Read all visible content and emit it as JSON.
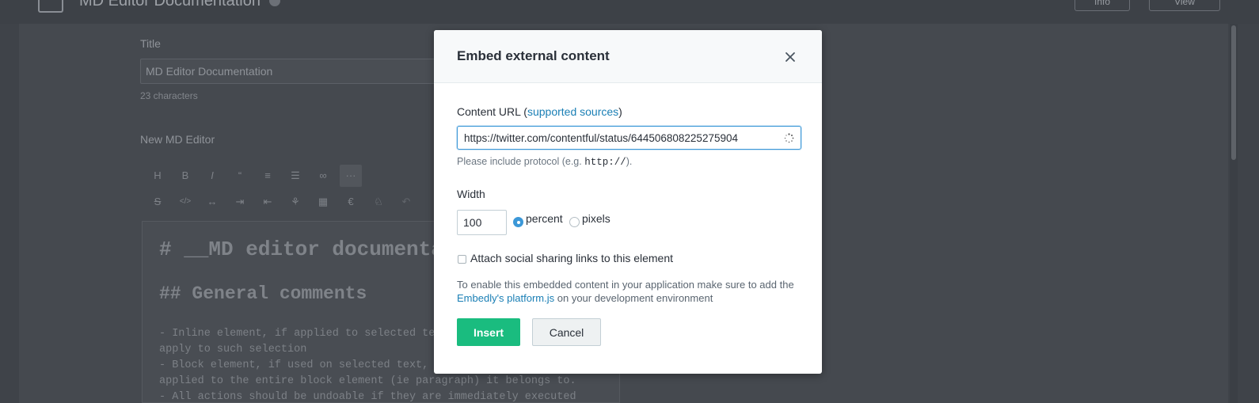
{
  "background": {
    "page_title": "MD Editor Documentation",
    "header_buttons": {
      "info": "Info",
      "view": "View"
    },
    "title_label": "Title",
    "title_value": "MD Editor Documentation",
    "char_count": "23 characters",
    "editor_label": "New MD Editor",
    "toolbar_row1": [
      "H",
      "B",
      "I",
      "“",
      "≡",
      "☰",
      "∞",
      "···"
    ],
    "toolbar_row2": [
      "S",
      "</>",
      "↔",
      "⇥",
      "⇤",
      "⚘",
      "▦",
      "€",
      "♘",
      "↶"
    ],
    "content": {
      "h1": "# __MD editor documenta",
      "h2": "## General comments",
      "lines": [
        "- Inline element, if applied to selected tex",
        "apply to such selection",
        "- Block element, if used on selected text, t",
        "applied to the entire block element (ie paragraph) it belongs to.",
        "- All actions should be undoable if they are immediately executed"
      ]
    }
  },
  "modal": {
    "title": "Embed external content",
    "close_icon": "close-icon",
    "url_label_prefix": "Content URL (",
    "url_label_link": "supported sources",
    "url_label_suffix": ")",
    "url_value": "https://twitter.com/contentful/status/644506808225275904",
    "hint_prefix": "Please include protocol (e.g. ",
    "hint_code": "http://",
    "hint_suffix": ").",
    "width_label": "Width",
    "width_value": "100",
    "unit_percent": "percent",
    "unit_pixels": "pixels",
    "selected_unit": "percent",
    "social_label": "Attach social sharing links to this element",
    "social_checked": false,
    "note_prefix": "To enable this embedded content in your application make sure to add the ",
    "note_link": "Embedly's platform.js",
    "note_suffix": " on your development environment",
    "insert_label": "Insert",
    "cancel_label": "Cancel"
  },
  "colors": {
    "accent_blue": "#3c98d8",
    "link_blue": "#1a7fb5",
    "insert_green": "#1abc7f",
    "overlay": "#3f4349"
  }
}
